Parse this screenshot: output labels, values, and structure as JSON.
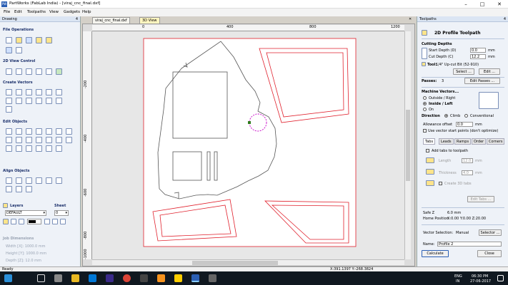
{
  "window": {
    "title": "PartWorks (FabLab India) - [viraj_cnc_final.dxf]",
    "logo": "PW",
    "minimize": "–",
    "maximize": "□",
    "close": "✕"
  },
  "menu": [
    "File",
    "Edit",
    "Toolpaths",
    "View",
    "Gadgets",
    "Help"
  ],
  "left": {
    "header": "Drawing",
    "pin": "4",
    "sections": {
      "file_ops": "File Operations",
      "view_ctrl": "2D View Control",
      "create": "Create Vectors",
      "edit": "Edit Objects",
      "align": "Align Objects"
    },
    "layers_label": "Layers",
    "sheet_label": "Sheet",
    "layer_value": "DEFAULT",
    "sheet_value": "0",
    "job_title": "Job Dimensions",
    "job_width": "Width  [X]: 1000.0 mm",
    "job_height": "Height [Y]: 1000.0 mm",
    "job_depth": "Depth  [Z]: 12.0 mm"
  },
  "tabs": {
    "doc": "viraj_cnc_final.dxf",
    "view3d": "3D View",
    "doc_close": "✕"
  },
  "rulers": {
    "h": [
      "0",
      "400",
      "800",
      "1200"
    ],
    "v": [
      "-200",
      "-400",
      "-600",
      "-800",
      "-1000"
    ]
  },
  "status": {
    "left": "Ready",
    "coords": "X:391.1397 Y:-268.3824"
  },
  "right": {
    "header": "Toolpaths",
    "pin": "4",
    "title": "2D Profile Toolpath",
    "cutting_depths": "Cutting Depths",
    "start_depth_label": "Start Depth (D)",
    "start_depth": "0.0",
    "unit": "mm",
    "cut_depth_label": "Cut Depth (C)",
    "cut_depth": "12.2",
    "tool_label": "Tool:",
    "tool_value": "1/4\" Up-cut Bit (52-910)",
    "select_btn": "Select ...",
    "edit_btn": "Edit ...",
    "passes_label": "Passes:",
    "passes_value": "3",
    "edit_passes_btn": "Edit Passes ...",
    "machine_vectors": "Machine Vectors...",
    "outside": "Outside / Right",
    "inside": "Inside / Left",
    "on": "On",
    "direction": "Direction",
    "climb": "Climb",
    "conventional": "Conventional",
    "allowance_label": "Allowance offset",
    "allowance": "0.0",
    "use_vector_start": "Use vector start points (don't optimize)",
    "subtabs": [
      "Tabs",
      "Leads",
      "Ramps",
      "Order",
      "Corners"
    ],
    "add_tabs": "Add tabs to toolpath",
    "length_label": "Length",
    "length_val": "12.0",
    "thickness_label": "Thickness",
    "thickness_val": "4.0",
    "create3d": "Create 3D tabs",
    "edit_tabs_btn": "Edit Tabs ...",
    "safez_label": "Safe Z",
    "safez": "6.0 mm",
    "home_label": "Home Position",
    "home": "X:0.00 Y:0.00 Z:20.00",
    "vector_sel_label": "Vector Selection:",
    "vector_sel": "Manual",
    "selector_btn": "Selector ...",
    "name_label": "Name:",
    "name_val": "Profile 2",
    "calculate_btn": "Calculate",
    "close_btn": "Close"
  },
  "taskbar": {
    "lang": "ENG",
    "region": "IN",
    "time": "06:30 PM",
    "date": "27-06-2017"
  },
  "colors": {
    "toolpath_red": "#e0202c",
    "vector_dark": "#555555",
    "selection_magenta": "#c800c8",
    "accent_blue": "#2b5fb4"
  }
}
